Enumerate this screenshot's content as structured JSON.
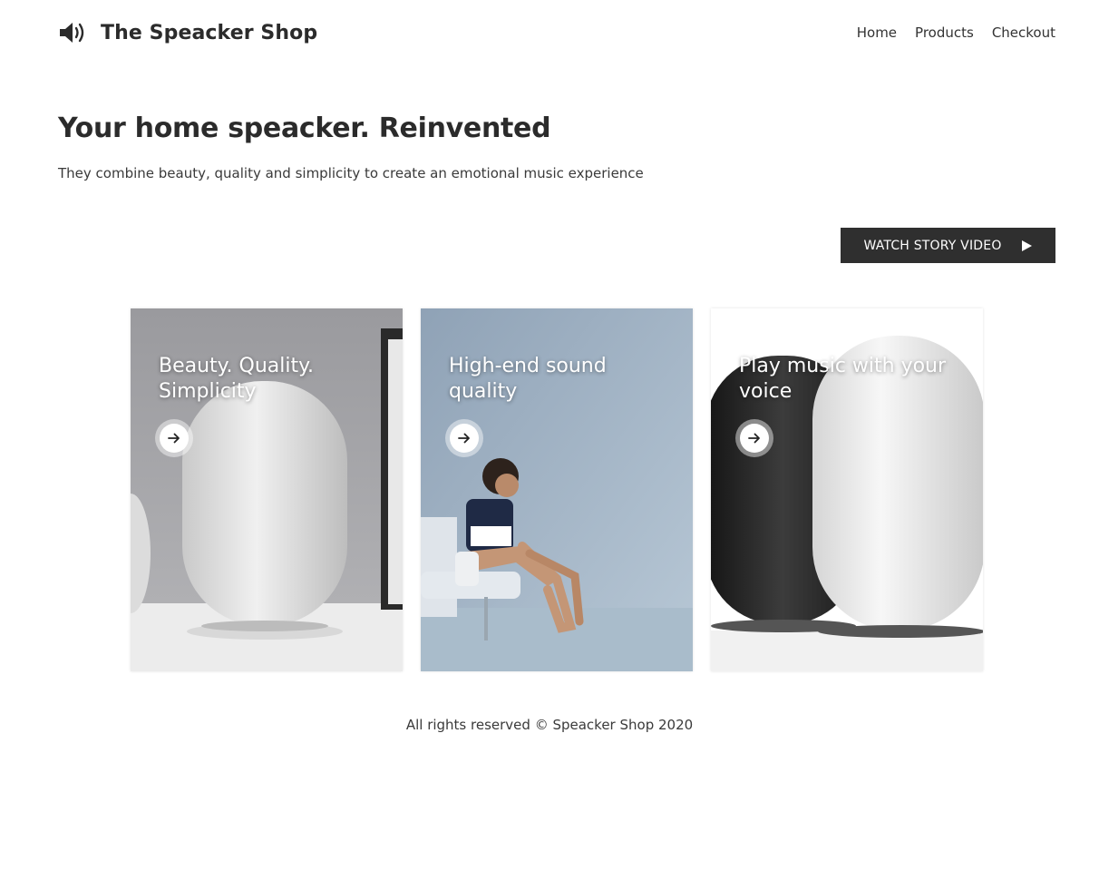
{
  "header": {
    "brand_icon": "speaker-volume-icon",
    "brand_title": "The Speacker Shop",
    "nav": [
      {
        "label": "Home"
      },
      {
        "label": "Products"
      },
      {
        "label": "Checkout"
      }
    ]
  },
  "hero": {
    "title": "Your home speacker. Reinvented",
    "subtitle": "They combine beauty, quality and simplicity to create an emotional music experience",
    "watch_button": {
      "label": "WATCH STORY VIDEO",
      "icon": "play-icon"
    }
  },
  "cards": [
    {
      "title": "Beauty. Quality. Simplicity",
      "icon": "arrow-right-icon"
    },
    {
      "title": "High-end sound quality",
      "icon": "arrow-right-icon"
    },
    {
      "title": "Play music with your voice",
      "icon": "arrow-right-icon"
    }
  ],
  "footer": {
    "text": "All rights reserved © Speacker Shop 2020"
  },
  "colors": {
    "text": "#2b2b2b",
    "button_bg": "#2f2f2f",
    "background": "#ffffff"
  }
}
